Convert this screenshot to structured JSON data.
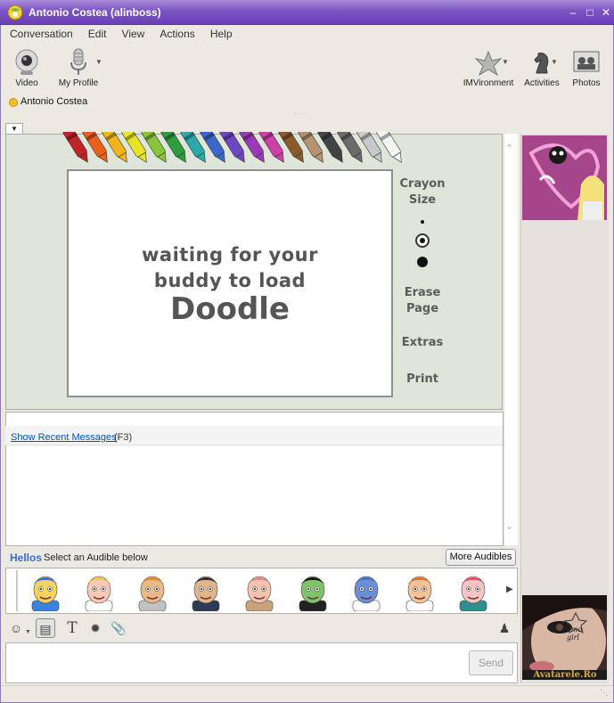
{
  "window": {
    "title": "Antonio Costea (alinboss)",
    "accent": "#7c55c4"
  },
  "menu": [
    "Conversation",
    "Edit",
    "View",
    "Actions",
    "Help"
  ],
  "toolbar": {
    "video_label": "Video",
    "profile_label": "My Profile",
    "imvironment_label": "IMVironment",
    "activities_label": "Activities",
    "photos_label": "Photos"
  },
  "buddy": {
    "name": "Antonio Costea",
    "status_color": "#f5c024"
  },
  "doodle": {
    "waiting_line1": "waiting for your",
    "waiting_line2": "buddy to load",
    "word": "Doodle",
    "crayon_size_line1": "Crayon",
    "crayon_size_line2": "Size",
    "erase_line1": "Erase",
    "erase_line2": "Page",
    "extras": "Extras",
    "print": "Print",
    "crayon_colors": [
      "#c0242b",
      "#e8601c",
      "#f2b51b",
      "#e9e327",
      "#8ac43a",
      "#2f9c3f",
      "#29a9a8",
      "#3a67c9",
      "#6d46c2",
      "#9b3ab8",
      "#cf3fa8",
      "#8a5a2c",
      "#b49272",
      "#444444",
      "#6b6b6b",
      "#c9c9c9",
      "#f4f4f4"
    ]
  },
  "messages": {
    "recent_link": "Show Recent Messages",
    "recent_key": "(F3)"
  },
  "audibles": {
    "title": "Hellos",
    "subtitle": "Select an Audible below",
    "more_button": "More Audibles"
  },
  "input": {
    "send_label": "Send"
  },
  "avatars": {
    "my_caption": "emo girl",
    "watermark": "Avatarele.Ro"
  }
}
